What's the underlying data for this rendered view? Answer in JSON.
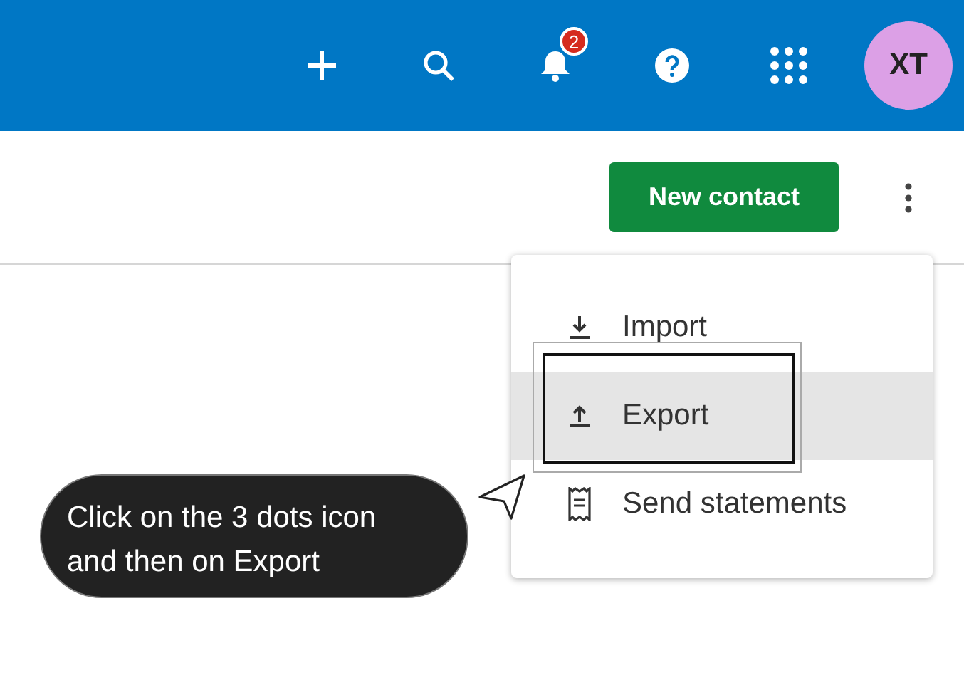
{
  "header": {
    "notification_count": "2",
    "avatar": "XT"
  },
  "toolbar": {
    "primary_button": "New contact"
  },
  "menu": {
    "items": [
      {
        "label": "Import",
        "kind": "import",
        "selected": false
      },
      {
        "label": "Export",
        "kind": "export",
        "selected": true
      },
      {
        "label": "Send statements",
        "kind": "statements",
        "selected": false
      }
    ]
  },
  "callout": {
    "text": "Click on the 3 dots icon and then on Export"
  }
}
